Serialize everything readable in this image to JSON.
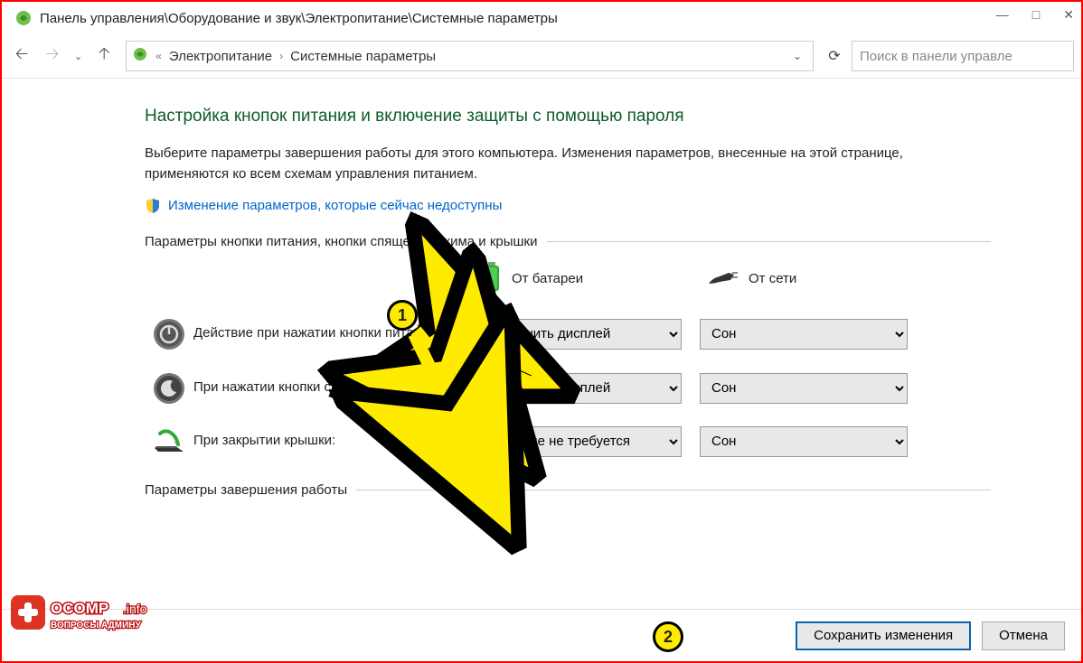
{
  "title_bar": {
    "path": "Панель управления\\Оборудование и звук\\Электропитание\\Системные параметры"
  },
  "win_controls": {
    "min": "—",
    "max": "□",
    "close": "✕"
  },
  "nav": {
    "crumb_prefix": "«",
    "crumb1": "Электропитание",
    "sep": "›",
    "crumb2": "Системные параметры",
    "trail_chevron": "⌄",
    "refresh": "⟳"
  },
  "search": {
    "placeholder": "Поиск в панели управле"
  },
  "content": {
    "heading": "Настройка кнопок питания и включение защиты с помощью пароля",
    "description": "Выберите параметры завершения работы для этого компьютера. Изменения параметров, внесенные на этой странице, применяются ко всем схемам управления питанием.",
    "change_link": "Изменение параметров, которые сейчас недоступны",
    "group1": "Параметры кнопки питания, кнопки спящего режима и крышки",
    "col_battery": "От батареи",
    "col_plugged": "От сети",
    "rows": [
      {
        "label": "Действие при нажатии кнопки питания:",
        "battery": "Отключить дисплей",
        "plugged": "Сон"
      },
      {
        "label": "При нажатии кнопки сна:",
        "battery": "Отключить дисплей",
        "plugged": "Сон"
      },
      {
        "label": "При закрытии крышки:",
        "battery": "Действие не требуется",
        "plugged": "Сон"
      }
    ],
    "group2": "Параметры завершения работы"
  },
  "footer": {
    "save": "Сохранить изменения",
    "cancel": "Отмена"
  },
  "callouts": {
    "one": "1",
    "two": "2"
  },
  "watermark": {
    "brand": "OCOMP",
    "tld": ".info",
    "sub": "ВОПРОСЫ АДМИНУ"
  }
}
